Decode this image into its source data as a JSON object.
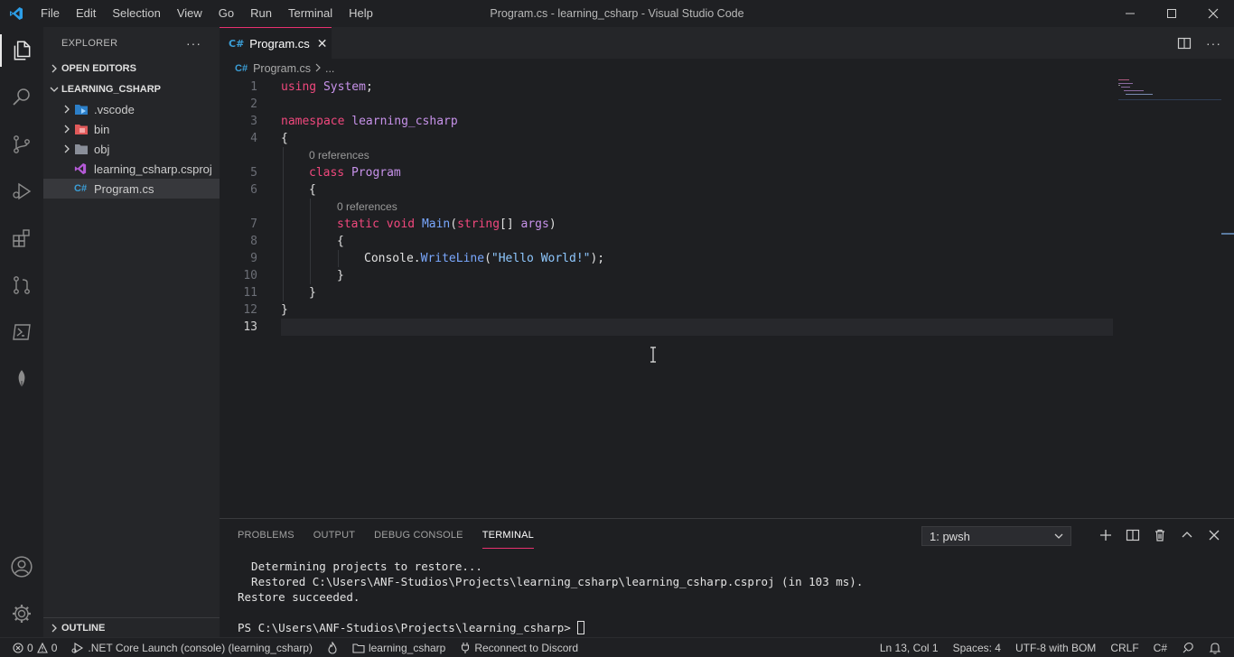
{
  "window": {
    "title": "Program.cs - learning_csharp - Visual Studio Code",
    "menu": [
      "File",
      "Edit",
      "Selection",
      "View",
      "Go",
      "Run",
      "Terminal",
      "Help"
    ]
  },
  "sidebar": {
    "title": "EXPLORER",
    "open_editors": "OPEN EDITORS",
    "project": "LEARNING_CSHARP",
    "items": [
      {
        "label": ".vscode",
        "icon": "vscode-folder-icon"
      },
      {
        "label": "bin",
        "icon": "folder-icon"
      },
      {
        "label": "obj",
        "icon": "folder-icon"
      },
      {
        "label": "learning_csharp.csproj",
        "icon": "csproj-icon"
      },
      {
        "label": "Program.cs",
        "icon": "csharp-file-icon"
      }
    ],
    "outline": "OUTLINE"
  },
  "editor": {
    "tab_label": "Program.cs",
    "tab_icon_text": "C#",
    "breadcrumb_file": "Program.cs",
    "breadcrumb_more": "...",
    "code_lens": "0 references",
    "line_numbers": [
      "1",
      "2",
      "3",
      "4",
      "5",
      "6",
      "7",
      "8",
      "9",
      "10",
      "11",
      "12",
      "13"
    ],
    "code": {
      "l1_kw": "using",
      "l1_ns": "System",
      "l1_end": ";",
      "l3_kw": "namespace",
      "l3_name": "learning_csharp",
      "l4": "{",
      "l5_kw": "class",
      "l5_name": "Program",
      "l6": "{",
      "l7_kw1": "static",
      "l7_kw2": "void",
      "l7_fn": "Main",
      "l7_p1": "(",
      "l7_type": "string",
      "l7_br": "[] ",
      "l7_arg": "args",
      "l7_p2": ")",
      "l8": "{",
      "l9_obj": "Console.",
      "l9_fn": "WriteLine",
      "l9_p1": "(",
      "l9_str": "\"Hello World!\"",
      "l9_end": ");",
      "l10": "}",
      "l11": "}",
      "l12": "}"
    }
  },
  "panel": {
    "tabs": [
      "PROBLEMS",
      "OUTPUT",
      "DEBUG CONSOLE",
      "TERMINAL"
    ],
    "terminal_select": "1: pwsh",
    "lines": [
      "  Determining projects to restore...",
      "  Restored C:\\Users\\ANF-Studios\\Projects\\learning_csharp\\learning_csharp.csproj (in 103 ms).",
      "Restore succeeded.",
      "",
      "PS C:\\Users\\ANF-Studios\\Projects\\learning_csharp> "
    ]
  },
  "statusbar": {
    "errors": "0",
    "warnings": "0",
    "launch": ".NET Core Launch (console) (learning_csharp)",
    "project": "learning_csharp",
    "discord": "Reconnect to Discord",
    "position": "Ln 13, Col 1",
    "spaces": "Spaces: 4",
    "encoding": "UTF-8 with BOM",
    "eol": "CRLF",
    "language": "C#"
  },
  "colors": {
    "accent": "#e8316f",
    "keyword": "#f0487d",
    "type": "#c792ea",
    "function": "#7aa8ff",
    "string": "#8fc8ff"
  }
}
